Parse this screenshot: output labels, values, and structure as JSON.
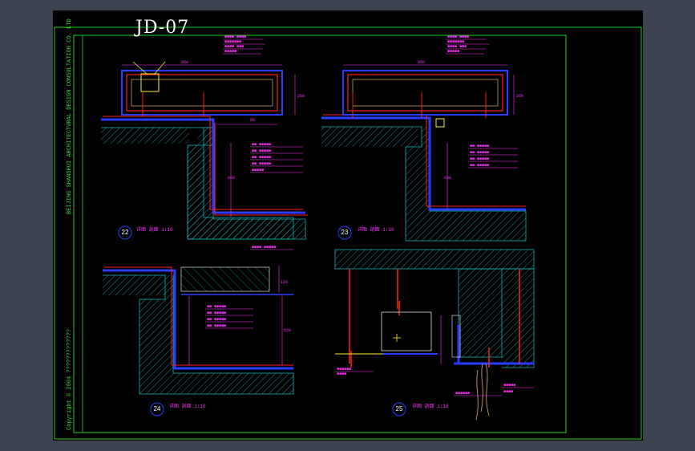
{
  "drawing": {
    "title": "JD-07",
    "side_text": "BEIJING SHANSHUI ARCHITECTURAL DESIGN CONSULTATION CO. LTD",
    "copyright": "Copyright © 2004 ?????????????",
    "details": [
      {
        "id": "22",
        "caption": "详图 剖面 1:10"
      },
      {
        "id": "23",
        "caption": "详图 剖面 1:10"
      },
      {
        "id": "24",
        "caption": "详图 剖面 1:10"
      },
      {
        "id": "25",
        "caption": "详图 剖面 1:10"
      }
    ]
  },
  "colors": {
    "background": "#3c4452",
    "sheet": "#000000",
    "border": "#22d622",
    "concrete": "#15b4b4",
    "dimension": "#ff30ff",
    "steel": "#ff2020",
    "finish": "#2a3cff",
    "annotation": "#ffffff",
    "accent": "#ffee33"
  }
}
